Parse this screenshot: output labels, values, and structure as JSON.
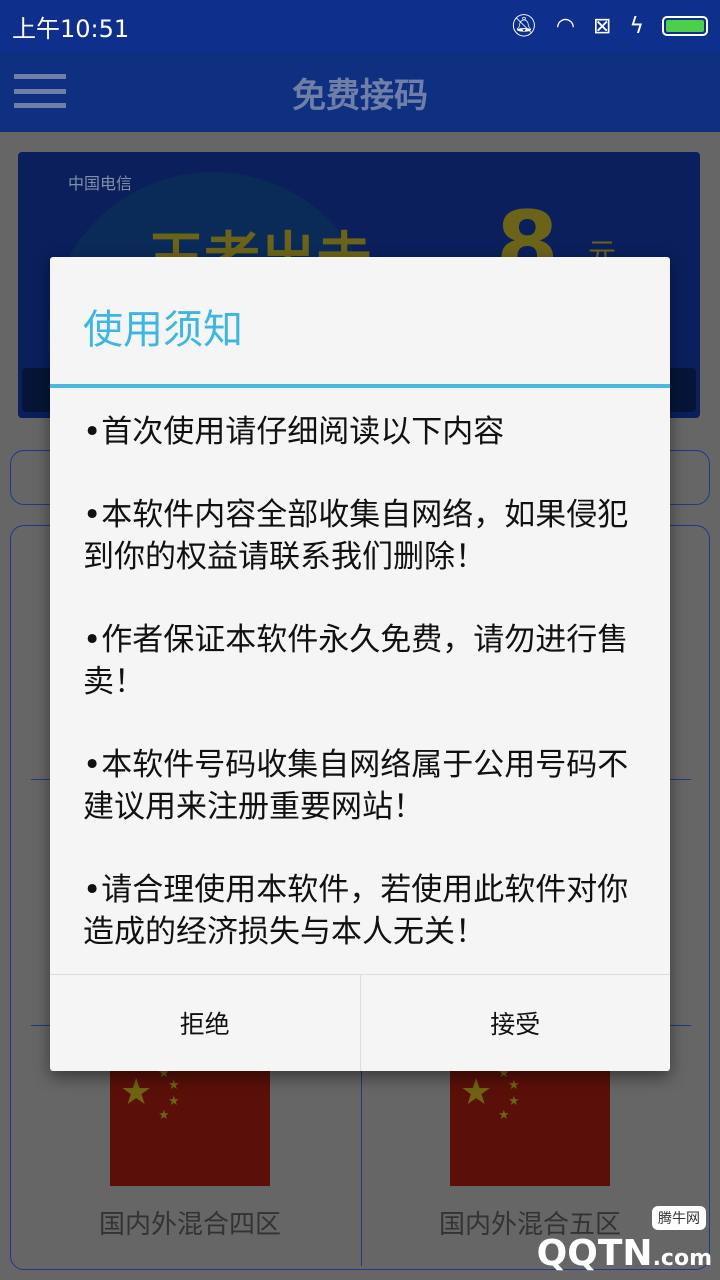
{
  "status_bar": {
    "time": "上午10:51",
    "icons": [
      "bell-muted-icon",
      "wifi-icon",
      "sim-x-icon",
      "charging-icon",
      "battery-icon"
    ]
  },
  "app_bar": {
    "title": "免费接码",
    "menu_icon": "hamburger-menu-icon"
  },
  "banner": {
    "logo": "中国电信",
    "slogan": "王者出击",
    "price": "8",
    "unit": "元"
  },
  "grid": {
    "items": [
      {
        "label": "国内外混合四区"
      },
      {
        "label": "国内外混合五区"
      }
    ]
  },
  "dialog": {
    "title": "使用须知",
    "paragraphs": [
      "•首次使用请仔细阅读以下内容",
      "•本软件内容全部收集自网络，如果侵犯到你的权益请联系我们删除！",
      "•作者保证本软件永久免费，请勿进行售卖！",
      "•本软件号码收集自网络属于公用号码不建议用来注册重要网站！",
      "•请合理使用本软件，若使用此软件对你造成的经济损失与本人无关！"
    ],
    "reject_label": "拒绝",
    "accept_label": "接受",
    "accent_color": "#3db6e2"
  },
  "watermark": {
    "text": "QQTN",
    "suffix": ".com",
    "tag": "腾牛网"
  }
}
